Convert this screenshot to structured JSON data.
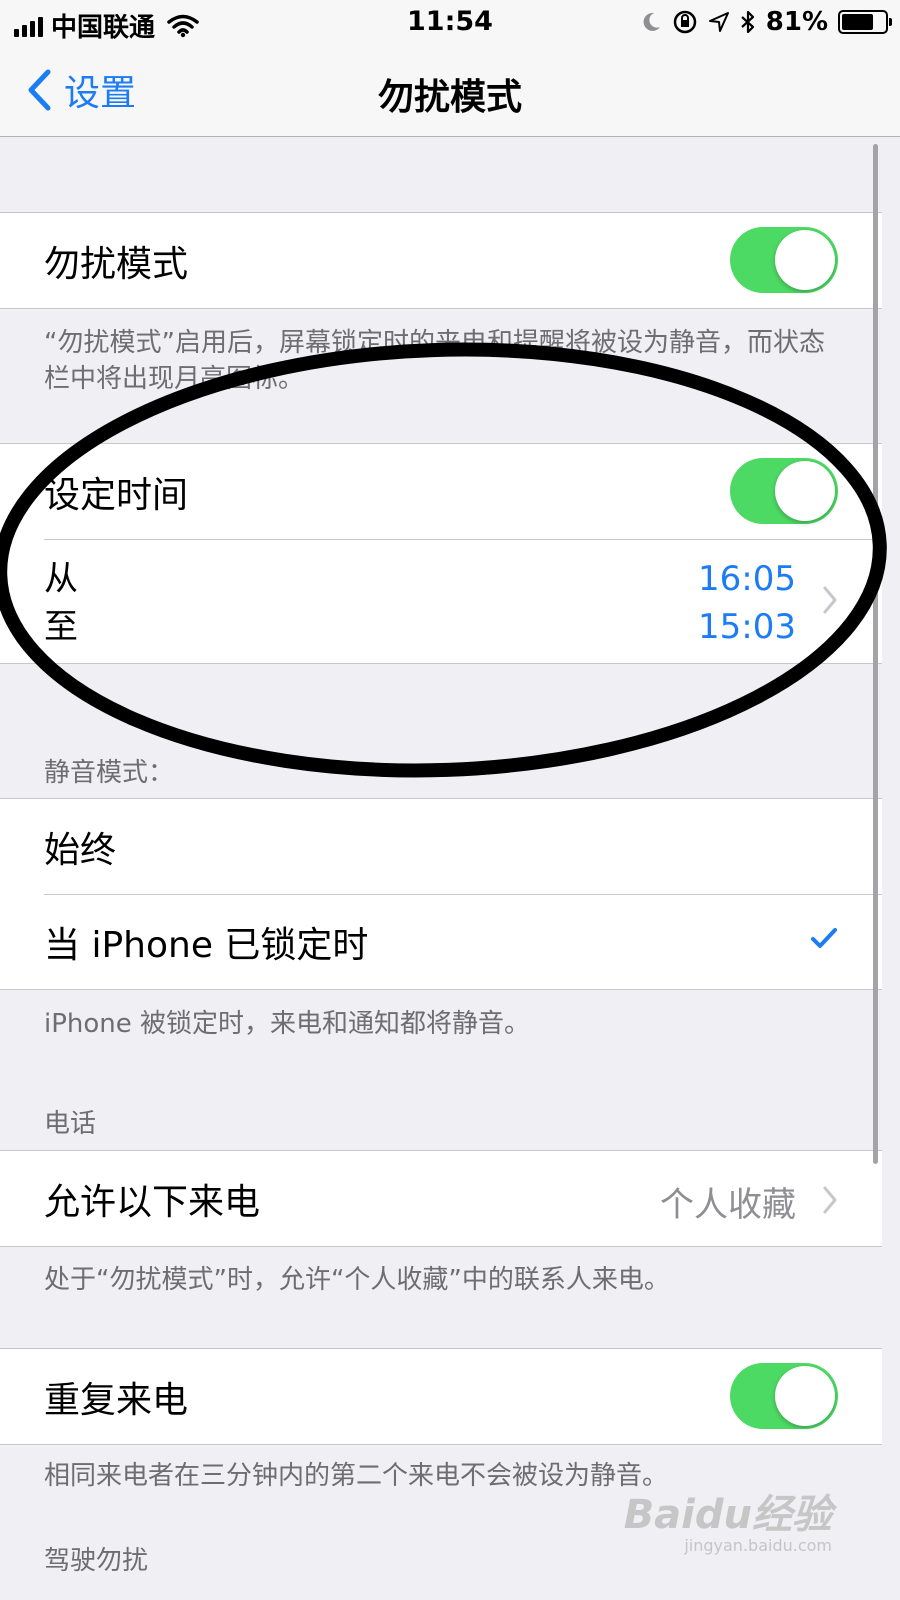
{
  "status_bar": {
    "carrier": "中国联通",
    "time": "11:54",
    "battery_percent": "81%",
    "battery_level": 0.81,
    "icons": [
      "signal-icon",
      "wifi-icon",
      "moon-icon",
      "orientation-lock-icon",
      "location-icon",
      "bluetooth-icon",
      "battery-icon"
    ]
  },
  "nav": {
    "back_label": "设置",
    "title": "勿扰模式"
  },
  "dnd": {
    "label": "勿扰模式",
    "enabled": true,
    "footer": "“勿扰模式”启用后，屏幕锁定时的来电和提醒将被设为静音，而状态栏中将出现月亮图标。"
  },
  "scheduled": {
    "label": "设定时间",
    "enabled": true,
    "from_label": "从",
    "to_label": "至",
    "from_time": "16:05",
    "to_time": "15:03"
  },
  "silence": {
    "header": "静音模式：",
    "always_label": "始终",
    "locked_label": "当 iPhone 已锁定时",
    "selected": "locked",
    "footer": "iPhone 被锁定时，来电和通知都将静音。"
  },
  "phone": {
    "header": "电话",
    "allow_calls_label": "允许以下来电",
    "allow_calls_value": "个人收藏",
    "footer": "处于“勿扰模式”时，允许“个人收藏”中的联系人来电。"
  },
  "repeated": {
    "label": "重复来电",
    "enabled": true,
    "footer": "相同来电者在三分钟内的第二个来电不会被设为静音。"
  },
  "driving": {
    "header": "驾驶勿扰"
  },
  "watermark": {
    "brand": "Baidu经验",
    "url": "jingyan.baidu.com"
  },
  "colors": {
    "accent": "#1c7cf4",
    "toggle_on": "#4cd964",
    "background": "#efeff4",
    "annotation": "#000000"
  }
}
